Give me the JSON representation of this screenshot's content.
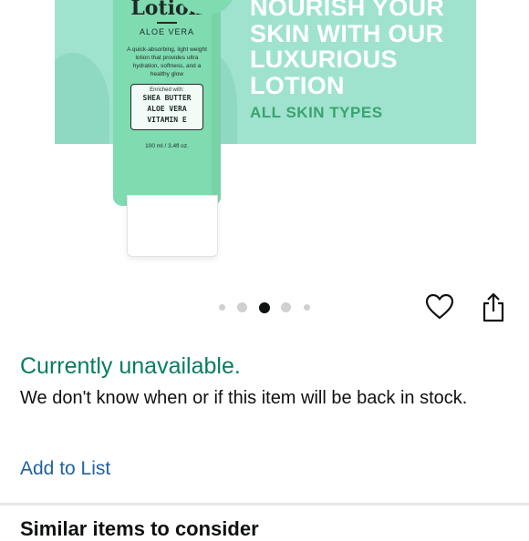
{
  "product_image": {
    "headline_lines": [
      "NOURISH YOUR",
      "SKIN WITH OUR",
      "LUXURIOUS",
      "LOTION"
    ],
    "subheading": "ALL SKIN TYPES",
    "bottle": {
      "title": "Lotion",
      "variant": "ALOE VERA",
      "description": "A quick-absorbing, light weight lotion that provides ultra hydration, softness, and a healthy glow",
      "enriched_label": "Enriched with:",
      "ingredients": [
        "SHEA BUTTER",
        "ALOE VERA",
        "VITAMIN E"
      ],
      "size": "100 ml / 3.4fl oz."
    },
    "colors": {
      "banner": "#9fe3cf",
      "bottle": "#7fdbb0",
      "accent_text": "#3aa36f"
    }
  },
  "carousel": {
    "total": 5,
    "active_index": 2
  },
  "actions": {
    "wishlist_icon": "heart-icon",
    "share_icon": "share-icon"
  },
  "availability": {
    "status": "Currently unavailable.",
    "status_color": "#067d62",
    "message": "We don't know when or if this item will be back in stock."
  },
  "add_to_list": "Add to List",
  "similar_section": {
    "title": "Similar items to consider"
  }
}
